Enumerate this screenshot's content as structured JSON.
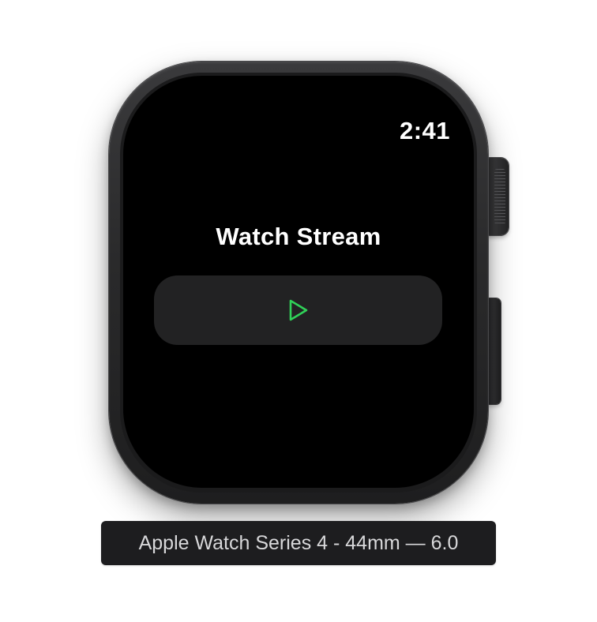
{
  "status_bar": {
    "time": "2:41"
  },
  "app": {
    "title": "Watch Stream",
    "play_button": {
      "icon": "play-icon",
      "accent_color": "#30d158"
    }
  },
  "device_label": "Apple Watch Series 4 - 44mm — 6.0",
  "colors": {
    "screen_background": "#000000",
    "button_background": "#222223",
    "text": "#ffffff"
  }
}
